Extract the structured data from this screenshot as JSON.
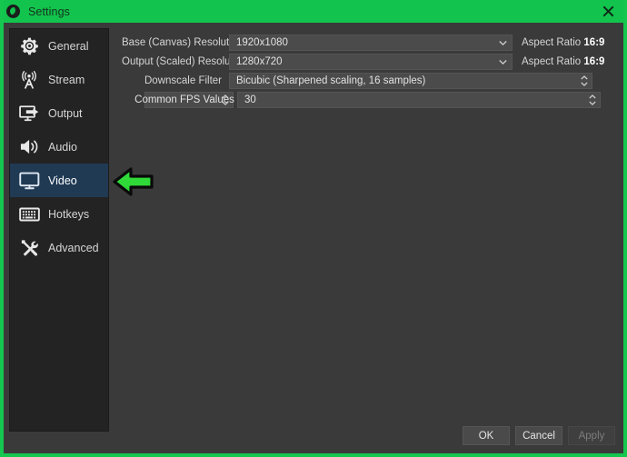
{
  "window": {
    "title": "Settings",
    "logo_icon": "obs-logo-icon",
    "close_icon": "close-icon",
    "accent_color": "#12c44d",
    "panel_background": "#3a3a3a",
    "sidebar_background": "#232323",
    "selection_color": "#203a54"
  },
  "sidebar": {
    "items": [
      {
        "label": "General",
        "icon": "gear-icon",
        "selected": false
      },
      {
        "label": "Stream",
        "icon": "broadcast-icon",
        "selected": false
      },
      {
        "label": "Output",
        "icon": "output-monitor-icon",
        "selected": false
      },
      {
        "label": "Audio",
        "icon": "speaker-icon",
        "selected": false
      },
      {
        "label": "Video",
        "icon": "monitor-icon",
        "selected": true
      },
      {
        "label": "Hotkeys",
        "icon": "keyboard-icon",
        "selected": false
      },
      {
        "label": "Advanced",
        "icon": "tools-icon",
        "selected": false
      }
    ]
  },
  "form": {
    "rows": [
      {
        "label": "Base (Canvas) Resolution",
        "value": "1920x1080",
        "control": "combobox",
        "aspect_label": "Aspect Ratio",
        "aspect_value": "16:9"
      },
      {
        "label": "Output (Scaled) Resolution",
        "value": "1280x720",
        "control": "combobox",
        "aspect_label": "Aspect Ratio",
        "aspect_value": "16:9"
      },
      {
        "label": "Downscale Filter",
        "value": "Bicubic (Sharpened scaling, 16 samples)",
        "control": "spinbox"
      },
      {
        "label": "Common FPS Values",
        "value": "30",
        "control": "spinbox"
      }
    ]
  },
  "annotation": {
    "arrow_icon": "green-left-arrow-annotation",
    "color": "#2fd938",
    "points_at": "sidebar-item-video"
  },
  "footer": {
    "ok_label": "OK",
    "cancel_label": "Cancel",
    "apply_label": "Apply",
    "apply_disabled": true
  }
}
